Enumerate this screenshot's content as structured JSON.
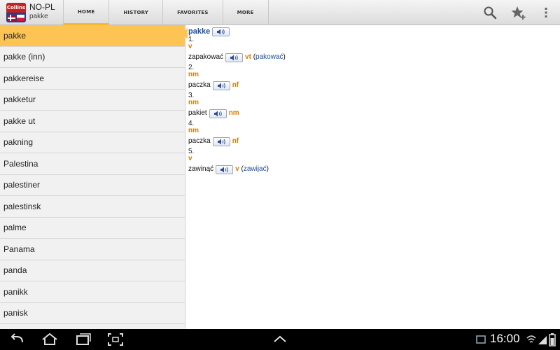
{
  "app": {
    "brand": "Collins",
    "title": "NO-PL",
    "current_word": "pakke"
  },
  "tabs": [
    {
      "label": "HOME",
      "active": true
    },
    {
      "label": "HISTORY",
      "active": false
    },
    {
      "label": "FAVORITES",
      "active": false
    },
    {
      "label": "MORE",
      "active": false
    }
  ],
  "actions": [
    "search-icon",
    "add-favorite-star-icon",
    "overflow-menu-icon"
  ],
  "word_list": [
    "pakke",
    "pakke (inn)",
    "pakkereise",
    "pakketur",
    "pakke ut",
    "pakning",
    "Palestina",
    "palestiner",
    "palestinsk",
    "palme",
    "Panama",
    "panda",
    "panikk",
    "panisk"
  ],
  "entry": {
    "headword": "pakke",
    "senses": [
      {
        "num": "1.",
        "pos": "v",
        "translation": "zapakować",
        "grammar": "vt",
        "aspect_open": " (",
        "aspect": "pakować",
        "aspect_close": ")"
      },
      {
        "num": "2.",
        "pos": "nm",
        "translation": "paczka",
        "grammar": "nf"
      },
      {
        "num": "3.",
        "pos": "nm",
        "translation": "pakiet",
        "grammar": "nm"
      },
      {
        "num": "4.",
        "pos": "nm",
        "translation": "paczka",
        "grammar": "nf"
      },
      {
        "num": "5.",
        "pos": "v",
        "translation": "zawinąć",
        "grammar": "v",
        "aspect_open": " (",
        "aspect": "zawijać",
        "aspect_close": ")"
      }
    ]
  },
  "status_bar": {
    "time": "16:00"
  },
  "colors": {
    "accent": "#fec453",
    "headword": "#1a4e9e",
    "pos": "#e07b00"
  }
}
